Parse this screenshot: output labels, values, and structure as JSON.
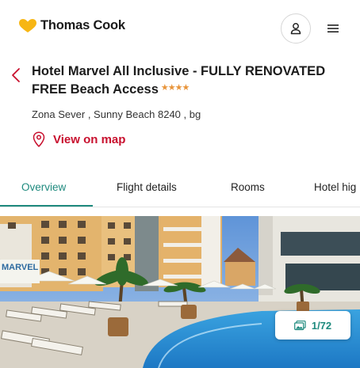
{
  "header": {
    "brand_name": "Thomas Cook",
    "logo_icon": "heart-logo-icon",
    "account_icon": "user-icon",
    "menu_icon": "hamburger-menu-icon"
  },
  "hotel": {
    "back_icon": "chevron-left-icon",
    "title": "Hotel Marvel All Inclusive - FULLY RENOVATED FREE Beach Access",
    "star_rating": 4,
    "stars_text": "★★★★",
    "address": "Zona Sever , Sunny Beach 8240 , bg",
    "map_link_label": "View on map",
    "map_icon": "map-pin-icon"
  },
  "tabs": [
    {
      "label": "Overview",
      "active": true
    },
    {
      "label": "Flight details",
      "active": false
    },
    {
      "label": "Rooms",
      "active": false
    },
    {
      "label": "Hotel hig",
      "active": false
    }
  ],
  "gallery": {
    "counter": "1/72",
    "counter_icon": "photo-gallery-icon",
    "image_label": "MARVEL"
  },
  "colors": {
    "accent": "#1e8a7e",
    "brand_red": "#c8102e",
    "star": "#e8943a",
    "logo_yellow": "#f7b614"
  }
}
